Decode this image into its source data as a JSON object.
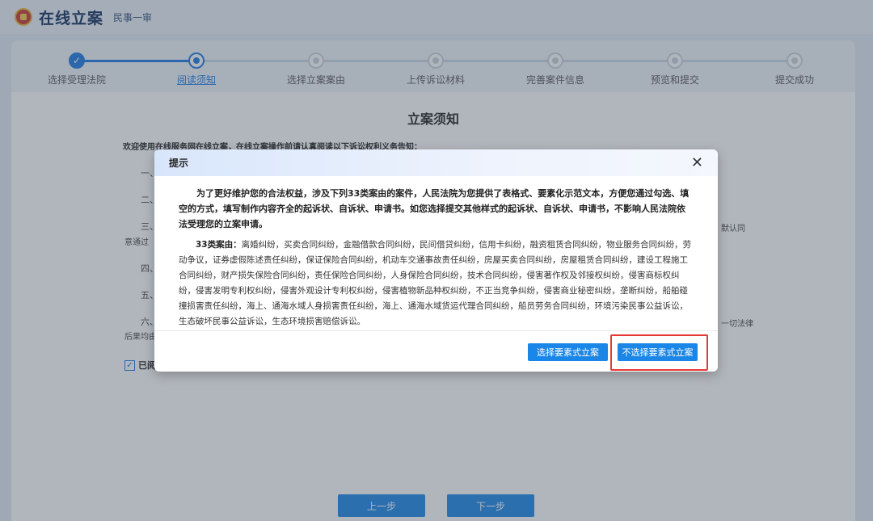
{
  "header": {
    "title": "在线立案",
    "subtitle": "民事一审"
  },
  "steps": [
    {
      "label": "选择受理法院",
      "state": "done"
    },
    {
      "label": "阅读须知",
      "state": "current"
    },
    {
      "label": "选择立案案由",
      "state": "pending"
    },
    {
      "label": "上传诉讼材料",
      "state": "pending"
    },
    {
      "label": "完善案件信息",
      "state": "pending"
    },
    {
      "label": "预览和提交",
      "state": "pending"
    },
    {
      "label": "提交成功",
      "state": "pending"
    }
  ],
  "notice": {
    "title": "立案须知",
    "intro": "欢迎使用在线服务网在线立案，在线立案操作前请认真阅读以下诉讼权利义务告知：",
    "items": [
      "一、",
      "二、",
      "三、",
      "四、",
      "五、",
      "六、"
    ],
    "fragments": {
      "default_agree": "默认同",
      "agree_passed": "意通过",
      "all_law": "一切法律",
      "consequence": "后果均由",
      "read_label": "已阅"
    }
  },
  "modal": {
    "title": "提示",
    "paragraph1": "为了更好维护您的合法权益，涉及下列33类案由的案件，人民法院为您提供了表格式、要素化示范文本，方便您通过勾选、填空的方式，填写制作内容齐全的起诉状、自诉状、申请书。如您选择提交其他样式的起诉状、自诉状、申请书，不影响人民法院依法受理您的立案申请。",
    "cases_label": "33类案由：",
    "cases_text": "离婚纠纷，买卖合同纠纷，金融借款合同纠纷，民间借贷纠纷，信用卡纠纷，融资租赁合同纠纷，物业服务合同纠纷，劳动争议，证券虚假陈述责任纠纷，保证保险合同纠纷，机动车交通事故责任纠纷，房屋买卖合同纠纷，房屋租赁合同纠纷，建设工程施工合同纠纷，财产损失保险合同纠纷，责任保险合同纠纷，人身保险合同纠纷，技术合同纠纷，侵害著作权及邻接权纠纷，侵害商标权纠纷，侵害发明专利权纠纷，侵害外观设计专利权纠纷，侵害植物新品种权纠纷，不正当竞争纠纷，侵害商业秘密纠纷，垄断纠纷，船舶碰撞损害责任纠纷，海上、通海水域人身损害责任纠纷，海上、通海水域货运代理合同纠纷，船员劳务合同纠纷，环境污染民事公益诉讼，生态破坏民事公益诉讼，生态环境损害赔偿诉讼。",
    "btn_element": "选择要素式立案",
    "btn_no_element": "不选择要素式立案"
  },
  "footer": {
    "prev": "上一步",
    "next": "下一步"
  },
  "colors": {
    "primary": "#1a86e8",
    "highlight": "#e53935"
  }
}
